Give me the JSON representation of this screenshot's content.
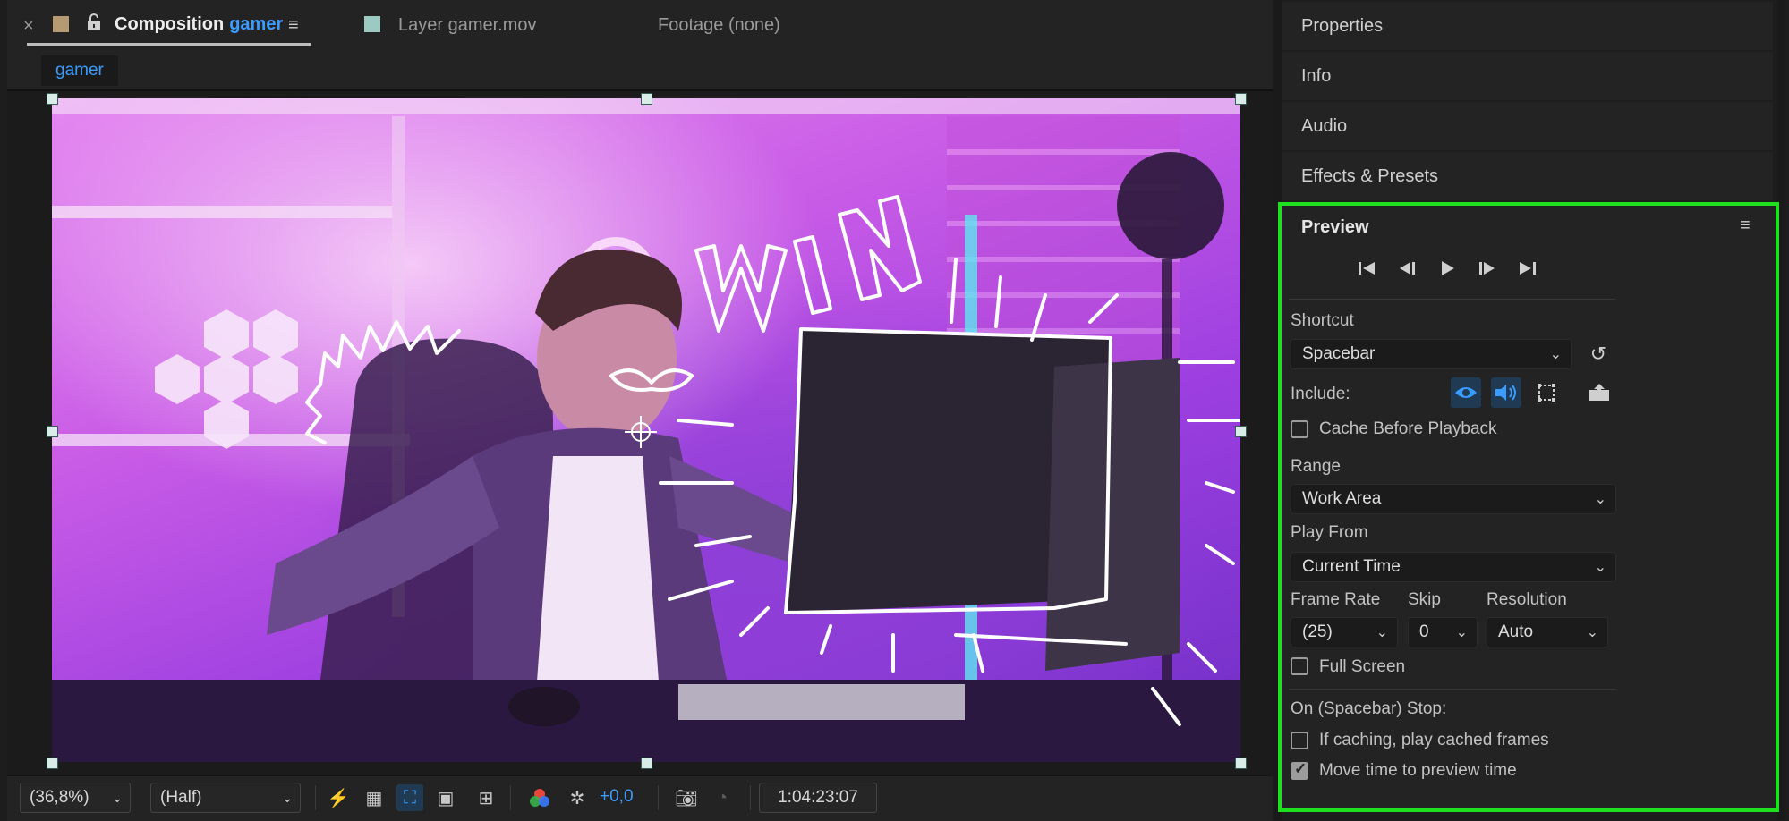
{
  "composition_panel": {
    "tabs": {
      "composition_prefix": "Composition",
      "composition_name": "gamer",
      "layer": "Layer gamer.mov",
      "footage": "Footage (none)"
    },
    "breadcrumb": "gamer",
    "viewer_bottom": {
      "zoom": "(36,8%)",
      "resolution": "(Half)",
      "exposure": "+0,0",
      "timecode": "1:04:23:07"
    }
  },
  "right_panels": {
    "properties": "Properties",
    "info": "Info",
    "audio": "Audio",
    "effects_presets": "Effects & Presets"
  },
  "preview": {
    "title": "Preview",
    "shortcut_label": "Shortcut",
    "shortcut_value": "Spacebar",
    "include_label": "Include:",
    "cache_before_playback": "Cache Before Playback",
    "cache_before_playback_checked": false,
    "range_label": "Range",
    "range_value": "Work Area",
    "play_from_label": "Play From",
    "play_from_value": "Current Time",
    "frame_rate_label": "Frame Rate",
    "frame_rate_value": "(25)",
    "skip_label": "Skip",
    "skip_value": "0",
    "resolution_label": "Resolution",
    "resolution_value": "Auto",
    "full_screen": "Full Screen",
    "full_screen_checked": false,
    "on_stop_label": "On (Spacebar) Stop:",
    "if_caching": "If caching, play cached frames",
    "if_caching_checked": false,
    "move_time": "Move time to preview time",
    "move_time_checked": true
  },
  "colors": {
    "accent_blue": "#3b9cff",
    "highlight_green": "#1fe01f",
    "panel_bg": "#232323"
  },
  "icons": {
    "close": "close-icon",
    "lock": "lock-icon",
    "menu": "hamburger-menu-icon",
    "first_frame": "first-frame-icon",
    "prev_frame": "previous-frame-icon",
    "play": "play-icon",
    "next_frame": "next-frame-icon",
    "last_frame": "last-frame-icon",
    "reset": "reset-icon",
    "eye": "eye-icon",
    "speaker": "speaker-icon",
    "overlays": "overlays-icon",
    "export": "export-icon",
    "camera": "snapshot-icon"
  }
}
